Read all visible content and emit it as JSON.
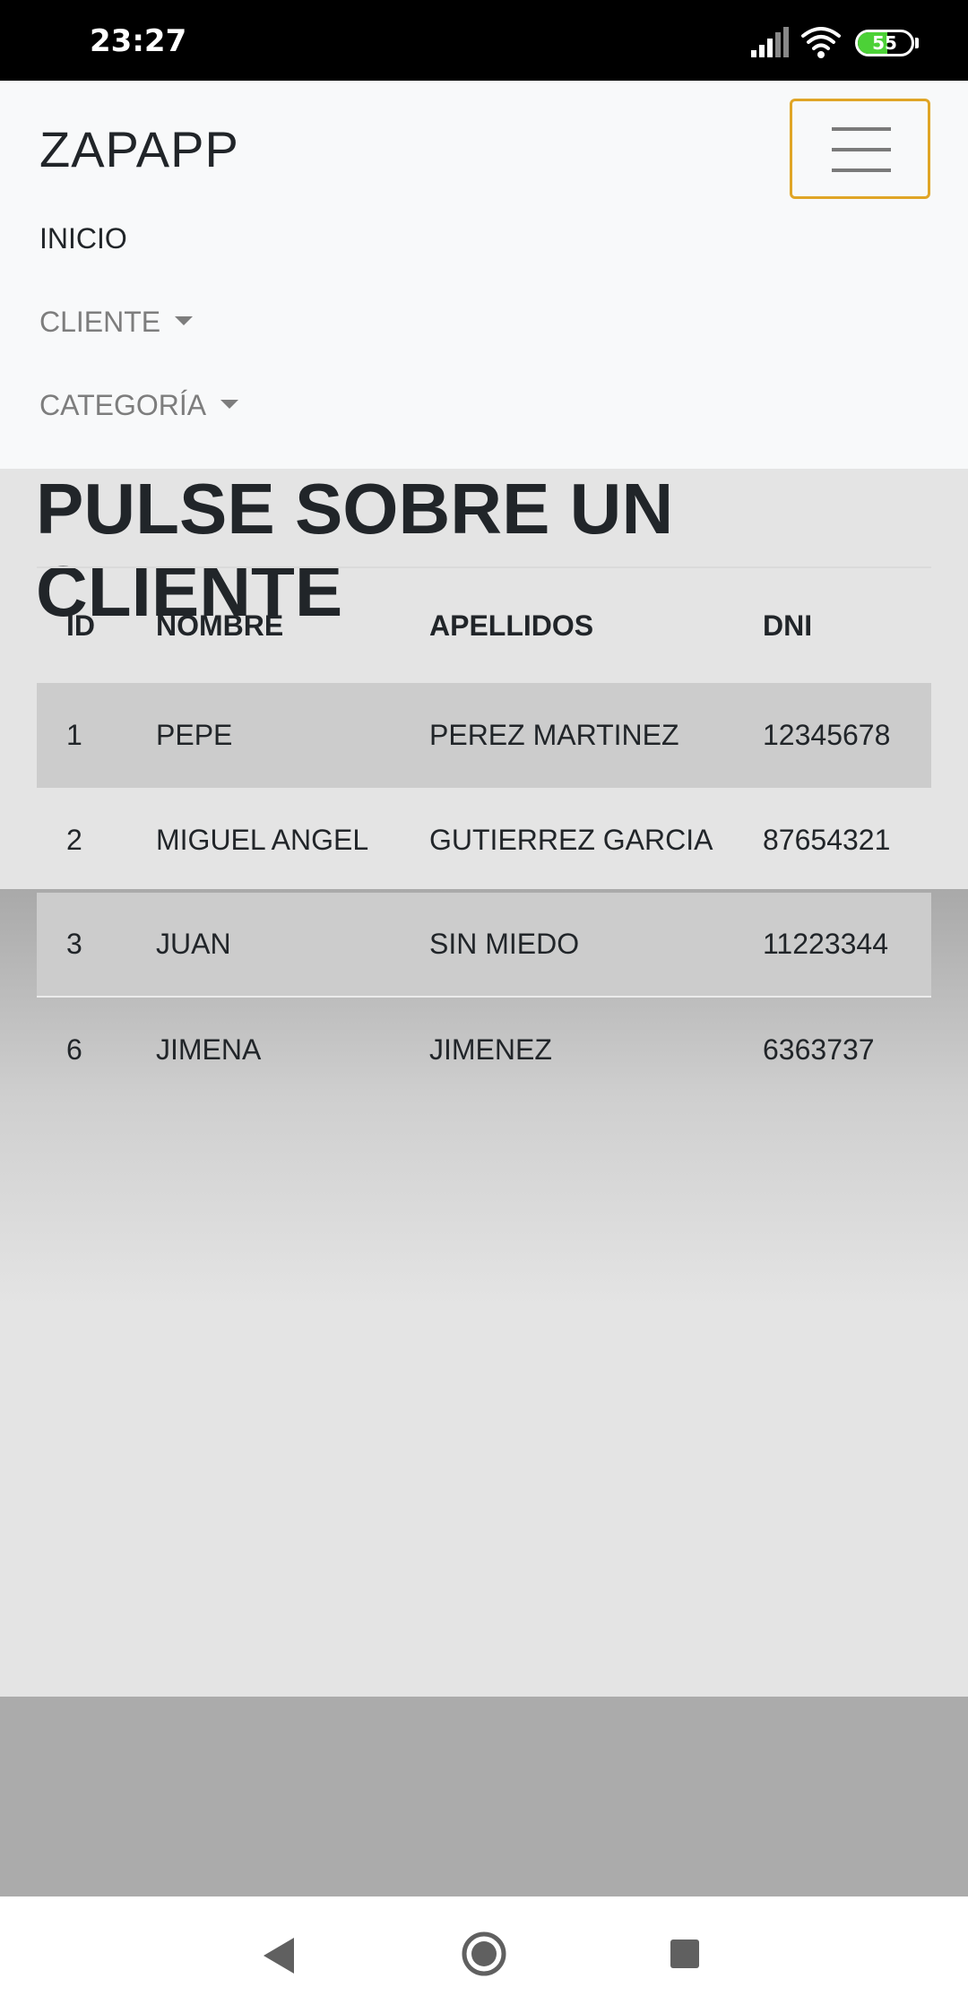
{
  "status_bar": {
    "time": "23:27",
    "battery_level": "55",
    "icons": [
      "signal-icon",
      "wifi-icon",
      "battery-icon"
    ]
  },
  "navbar": {
    "brand": "ZAPAPP",
    "menu": [
      {
        "label": "INICIO"
      },
      {
        "label": "CLIENTE"
      },
      {
        "label": "CATEGORÍA"
      }
    ],
    "toggler_border_color": "#e0a526"
  },
  "main": {
    "title": "PULSE SOBRE UN CLIENTE",
    "table": {
      "headers": [
        "ID",
        "NOMBRE",
        "APELLIDOS",
        "DNI"
      ],
      "rows": [
        [
          "1",
          "PEPE",
          "PEREZ MARTINEZ",
          "12345678"
        ],
        [
          "2",
          "MIGUEL ANGEL",
          "GUTIERREZ GARCIA",
          "87654321"
        ],
        [
          "3",
          "JUAN",
          "SIN MIEDO",
          "11223344"
        ],
        [
          "6",
          "JIMENA",
          "JIMENEZ",
          "6363737"
        ]
      ]
    }
  },
  "system_nav": {
    "icons": [
      "back-icon",
      "home-icon",
      "recents-icon"
    ]
  }
}
